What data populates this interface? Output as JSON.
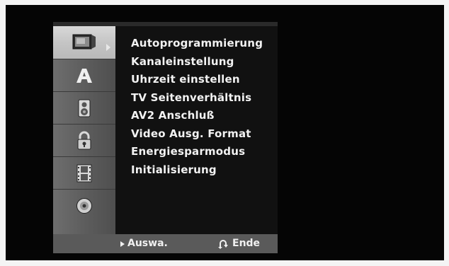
{
  "menu": {
    "icons": [
      "monitor-icon",
      "language-a-icon",
      "speaker-icon",
      "lock-icon",
      "film-icon",
      "disc-icon"
    ],
    "items": [
      "Autoprogrammierung",
      "Kanaleinstellung",
      "Uhrzeit einstellen",
      "TV Seitenverhältnis",
      "AV2 Anschluß",
      "Video Ausg. Format",
      "Energiesparmodus",
      "Initialisierung"
    ]
  },
  "footer": {
    "select_label": "Auswa.",
    "end_label": "Ende"
  },
  "colors": {
    "background": "#050505",
    "icon_column": "#5d5d5d",
    "selected_cell": "#c8c8c8",
    "text": "#f2f2f2",
    "footer_bar": "#5a5a5a"
  }
}
